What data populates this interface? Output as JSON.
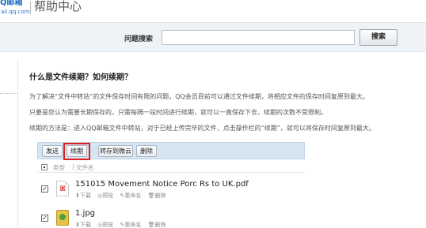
{
  "header": {
    "logo_top": "Q邮箱",
    "logo_bottom": "ail.qq.com",
    "title": "帮助中心"
  },
  "search": {
    "label": "问题搜索",
    "value": "",
    "placeholder": "",
    "button": "搜索"
  },
  "article": {
    "title": "什么是文件续期？如何续期？",
    "paragraphs": [
      "为了解决“文件中转站”的文件保存时间有限的问题，QQ会员目前可以通过文件续期，将相应文件的保存时间复原到最大。",
      "只要是您认为需要长期保存的，只需每隔一段时间进行续期，就可以一直保存下去，续期的次数不受限制。",
      "续期的方法是：进入QQ邮箱文件中转站，对于已经上传完毕的文件，点击操作栏的“续期”，就可以将保存时间复原到最大。"
    ]
  },
  "screenshot": {
    "toolbar": {
      "send": "发送",
      "renew": "续期",
      "save_to_cloud": "转存到微云",
      "delete": "删除"
    },
    "columns": {
      "type": "类型",
      "separator": "|",
      "name": "文件名"
    },
    "files": [
      {
        "name": "151015 Movement Notice Porc Rs to UK.pdf",
        "icon": "pdf-file-icon",
        "actions": [
          "⬇下载",
          "◎预览",
          "✎重命名",
          "🗑删除"
        ],
        "checked": "✓"
      },
      {
        "name": "1.jpg",
        "icon": "image-file-icon",
        "actions": [
          "⬇下载",
          "◎预览",
          "✎重命名",
          "🗑删除"
        ],
        "checked": "✓"
      }
    ],
    "highlight_color": "#e02020"
  }
}
